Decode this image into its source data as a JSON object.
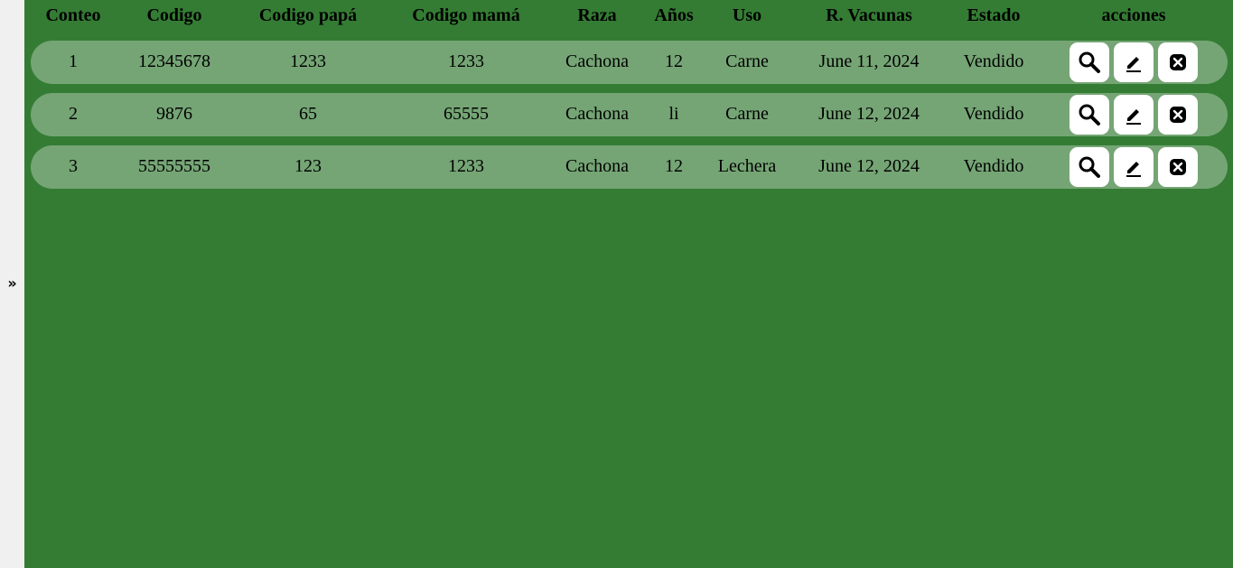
{
  "sidebar": {
    "toggle_glyph": "»",
    "toggle_icon": "double-chevron-right-icon"
  },
  "table": {
    "headers": [
      "Conteo",
      "Codigo",
      "Codigo papá",
      "Codigo mamá",
      "Raza",
      "Años",
      "Uso",
      "R. Vacunas",
      "Estado",
      "acciones"
    ],
    "rows": [
      {
        "conteo": "1",
        "codigo": "12345678",
        "codigo_papa": "1233",
        "codigo_mama": "1233",
        "raza": "Cachona",
        "anos": "12",
        "uso": "Carne",
        "vacunas": "June 11, 2024",
        "estado": "Vendido"
      },
      {
        "conteo": "2",
        "codigo": "9876",
        "codigo_papa": "65",
        "codigo_mama": "65555",
        "raza": "Cachona",
        "anos": "li",
        "uso": "Carne",
        "vacunas": "June 12, 2024",
        "estado": "Vendido"
      },
      {
        "conteo": "3",
        "codigo": "55555555",
        "codigo_papa": "123",
        "codigo_mama": "1233",
        "raza": "Cachona",
        "anos": "12",
        "uso": "Lechera",
        "vacunas": "June 12, 2024",
        "estado": "Vendido"
      }
    ],
    "action_icons": [
      "search-icon",
      "edit-icon",
      "delete-icon"
    ]
  },
  "colors": {
    "background": "#347c34",
    "row": "#75a575",
    "sidebar": "#f0f0f0",
    "button": "#ffffff"
  }
}
